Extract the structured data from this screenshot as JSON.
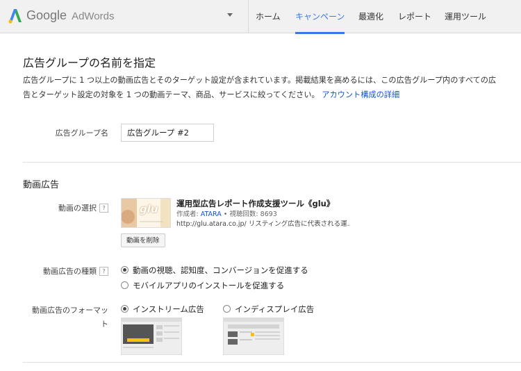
{
  "header": {
    "brand": "Google",
    "product": "AdWords",
    "nav": [
      {
        "label": "ホーム",
        "active": false
      },
      {
        "label": "キャンペーン",
        "active": true
      },
      {
        "label": "最適化",
        "active": false
      },
      {
        "label": "レポート",
        "active": false
      },
      {
        "label": "運用ツール",
        "active": false
      }
    ],
    "accent_color": "#3b78e7"
  },
  "page": {
    "title": "広告グループの名前を指定",
    "description_line1": "広告グループに 1 つ以上の動画広告とそのターゲット設定が含まれています。掲載結果を高めるには、この広告グループ内のすべての広",
    "description_line2": "告とターゲット設定の対象を 1 つの動画テーマ、商品、サービスに絞ってください。",
    "description_link": "アカウント構成の詳細"
  },
  "ad_group": {
    "label": "広告グループ名",
    "value": "広告グループ #2"
  },
  "video_ad": {
    "section_title": "動画広告",
    "select_label": "動画の選択",
    "help_mark": "?",
    "thumbnail_text": "glu",
    "video_title": "運用型広告レポート作成支援ツール《glu》",
    "creator_prefix": "作成者: ",
    "creator": "ATARA",
    "views": " • 視聴回数: 8693",
    "url": "http://glu.atara.co.jp/ リスティング広告に代表される運...",
    "remove_button": "動画を削除",
    "type_label": "動画広告の種類",
    "type_options": [
      {
        "label": "動画の視聴、認知度、コンバージョンを促進する",
        "selected": true
      },
      {
        "label": "モバイルアプリのインストールを促進する",
        "selected": false
      }
    ],
    "format_label_line1": "動画広告のフォーマッ",
    "format_label_line2": "ト",
    "format_options": [
      {
        "label": "インストリーム広告",
        "selected": true
      },
      {
        "label": "インディスプレイ広告",
        "selected": false
      }
    ]
  }
}
